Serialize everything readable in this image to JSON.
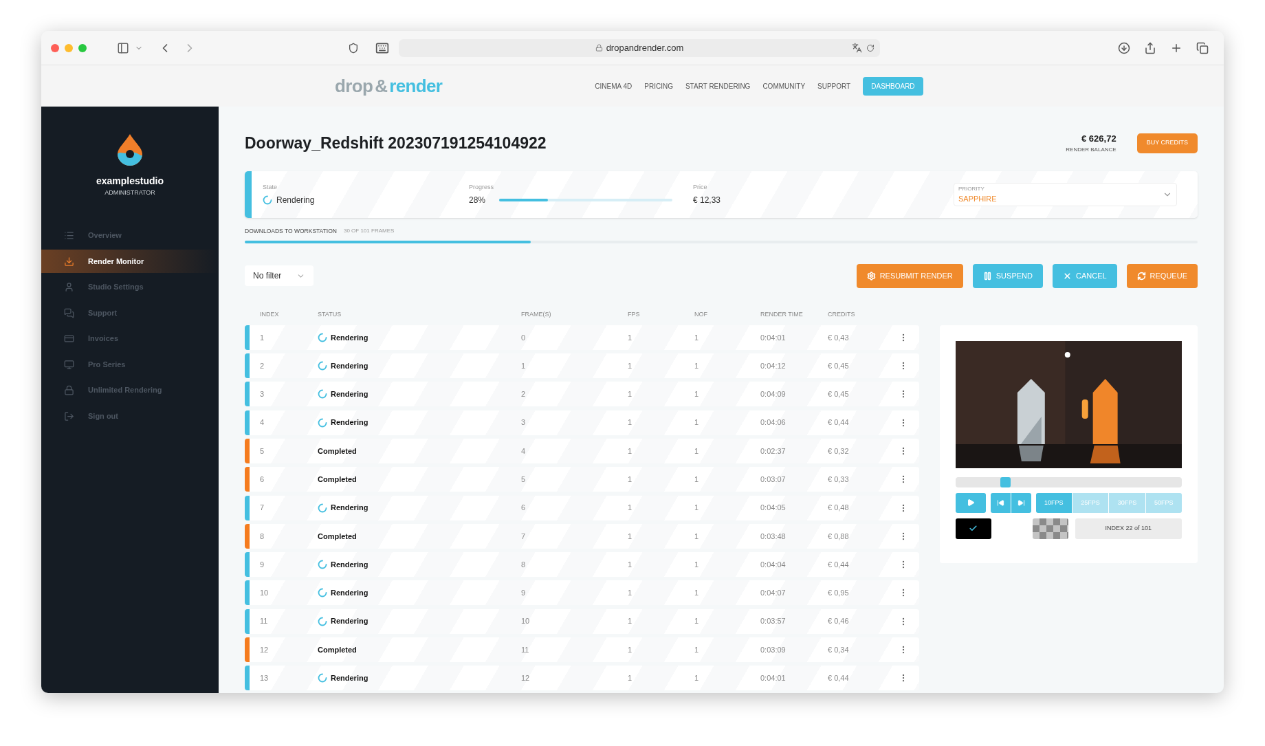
{
  "browser": {
    "url": "dropandrender.com"
  },
  "nav": {
    "logo_a": "drop",
    "logo_b": "&",
    "logo_c": "render",
    "links": [
      {
        "label": "CINEMA 4D",
        "selected": false
      },
      {
        "label": "PRICING",
        "selected": false
      },
      {
        "label": "START RENDERING",
        "selected": false
      },
      {
        "label": "COMMUNITY",
        "selected": false
      },
      {
        "label": "SUPPORT",
        "selected": false
      },
      {
        "label": "DASHBOARD",
        "selected": true
      }
    ]
  },
  "sidebar": {
    "studio": "examplestudio",
    "role": "ADMINISTRATOR",
    "items": [
      {
        "label": "Overview",
        "selected": false
      },
      {
        "label": "Render Monitor",
        "selected": true
      },
      {
        "label": "Studio Settings",
        "selected": false
      },
      {
        "label": "Support",
        "selected": false
      },
      {
        "label": "Invoices",
        "selected": false
      },
      {
        "label": "Pro Series",
        "selected": false
      },
      {
        "label": "Unlimited Rendering",
        "selected": false
      },
      {
        "label": "Sign out",
        "selected": false
      }
    ]
  },
  "title": "Doorway_Redshift 202307191254104922",
  "balance": {
    "amount": "€ 626,72",
    "label": "RENDER BALANCE",
    "button": "BUY CREDITS"
  },
  "summary": {
    "state_label": "State",
    "state": "Rendering",
    "progress_label": "Progress",
    "progress": "28%",
    "level": 0.28,
    "price_label": "Price",
    "price": "€ 12,33",
    "priority_label": "PRIORITY",
    "priority": "SAPPHIRE"
  },
  "downloads": {
    "label": "DOWNLOADS TO WORKSTATION",
    "count": "30 OF 101 FRAMES",
    "level": 0.3
  },
  "filter": {
    "value": "No filter"
  },
  "actions": [
    {
      "label": "RESUBMIT RENDER",
      "kind": "resubmit"
    },
    {
      "label": "SUSPEND",
      "kind": "suspend"
    },
    {
      "label": "CANCEL",
      "kind": "cancel"
    },
    {
      "label": "REQUEUE",
      "kind": "requeue"
    }
  ],
  "table": {
    "columns": [
      "INDEX",
      "STATUS",
      "FRAME(S)",
      "FPS",
      "NOF",
      "RENDER TIME",
      "CREDITS"
    ],
    "rows": [
      {
        "index": "1",
        "status": "Rendering",
        "kind": "rendering",
        "frame": "0",
        "fps": "1",
        "nof": "1",
        "time": "0:04:01",
        "credits": "€ 0,43"
      },
      {
        "index": "2",
        "status": "Rendering",
        "kind": "rendering",
        "frame": "1",
        "fps": "1",
        "nof": "1",
        "time": "0:04:12",
        "credits": "€ 0,45"
      },
      {
        "index": "3",
        "status": "Rendering",
        "kind": "rendering",
        "frame": "2",
        "fps": "1",
        "nof": "1",
        "time": "0:04:09",
        "credits": "€ 0,45"
      },
      {
        "index": "4",
        "status": "Rendering",
        "kind": "rendering",
        "frame": "3",
        "fps": "1",
        "nof": "1",
        "time": "0:04:06",
        "credits": "€ 0,44"
      },
      {
        "index": "5",
        "status": "Completed",
        "kind": "completed",
        "frame": "4",
        "fps": "1",
        "nof": "1",
        "time": "0:02:37",
        "credits": "€ 0,32"
      },
      {
        "index": "6",
        "status": "Completed",
        "kind": "completed",
        "frame": "5",
        "fps": "1",
        "nof": "1",
        "time": "0:03:07",
        "credits": "€ 0,33"
      },
      {
        "index": "7",
        "status": "Rendering",
        "kind": "rendering",
        "frame": "6",
        "fps": "1",
        "nof": "1",
        "time": "0:04:05",
        "credits": "€ 0,48"
      },
      {
        "index": "8",
        "status": "Completed",
        "kind": "completed",
        "frame": "7",
        "fps": "1",
        "nof": "1",
        "time": "0:03:48",
        "credits": "€ 0,88"
      },
      {
        "index": "9",
        "status": "Rendering",
        "kind": "rendering",
        "frame": "8",
        "fps": "1",
        "nof": "1",
        "time": "0:04:04",
        "credits": "€ 0,44"
      },
      {
        "index": "10",
        "status": "Rendering",
        "kind": "rendering",
        "frame": "9",
        "fps": "1",
        "nof": "1",
        "time": "0:04:07",
        "credits": "€ 0,95"
      },
      {
        "index": "11",
        "status": "Rendering",
        "kind": "rendering",
        "frame": "10",
        "fps": "1",
        "nof": "1",
        "time": "0:03:57",
        "credits": "€ 0,46"
      },
      {
        "index": "12",
        "status": "Completed",
        "kind": "completed",
        "frame": "11",
        "fps": "1",
        "nof": "1",
        "time": "0:03:09",
        "credits": "€ 0,34"
      },
      {
        "index": "13",
        "status": "Rendering",
        "kind": "rendering",
        "frame": "12",
        "fps": "1",
        "nof": "1",
        "time": "0:04:01",
        "credits": "€ 0,44"
      }
    ]
  },
  "preview": {
    "level": 0.22,
    "fps": [
      {
        "label": "10FPS",
        "selected": true
      },
      {
        "label": "25FPS",
        "selected": false
      },
      {
        "label": "30FPS",
        "selected": false
      },
      {
        "label": "50FPS",
        "selected": false
      }
    ],
    "backgrounds": [
      {
        "kind": "black",
        "selected": true
      },
      {
        "kind": "checker",
        "selected": false
      }
    ],
    "index": "INDEX 22 of 101"
  }
}
